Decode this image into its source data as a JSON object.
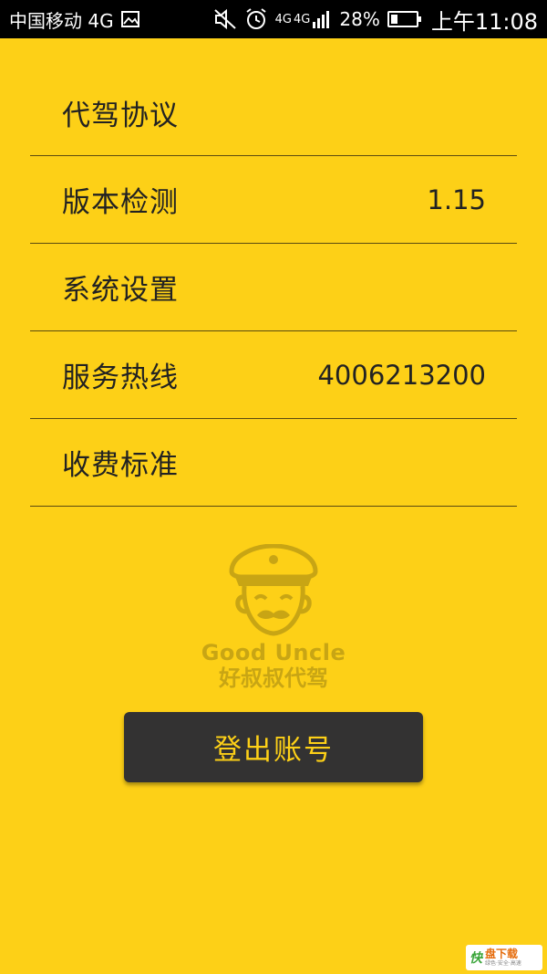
{
  "status_bar": {
    "carrier": "中国移动 4G",
    "network_small_1": "4G",
    "network_small_2": "4G",
    "battery_percent": "28%",
    "battery_level": 0.28,
    "time": "上午11:08",
    "icons": [
      "image-icon",
      "mute-icon",
      "alarm-icon",
      "signal-icon",
      "battery-icon"
    ]
  },
  "menu": {
    "items": [
      {
        "label": "代驾协议",
        "value": ""
      },
      {
        "label": "版本检测",
        "value": "1.15"
      },
      {
        "label": "系统设置",
        "value": ""
      },
      {
        "label": "服务热线",
        "value": "4006213200"
      },
      {
        "label": "收费标准",
        "value": ""
      }
    ]
  },
  "logo": {
    "name_en": "Good Uncle",
    "name_cn": "好叔叔代驾"
  },
  "logout": {
    "label": "登出账号"
  },
  "watermark": {
    "mark": "快",
    "main": "盘下载",
    "sub": "绿色·安全·高速"
  },
  "colors": {
    "background": "#FDD017",
    "button": "#333232",
    "button_text": "#FDD017",
    "logo": "#c8a514"
  }
}
